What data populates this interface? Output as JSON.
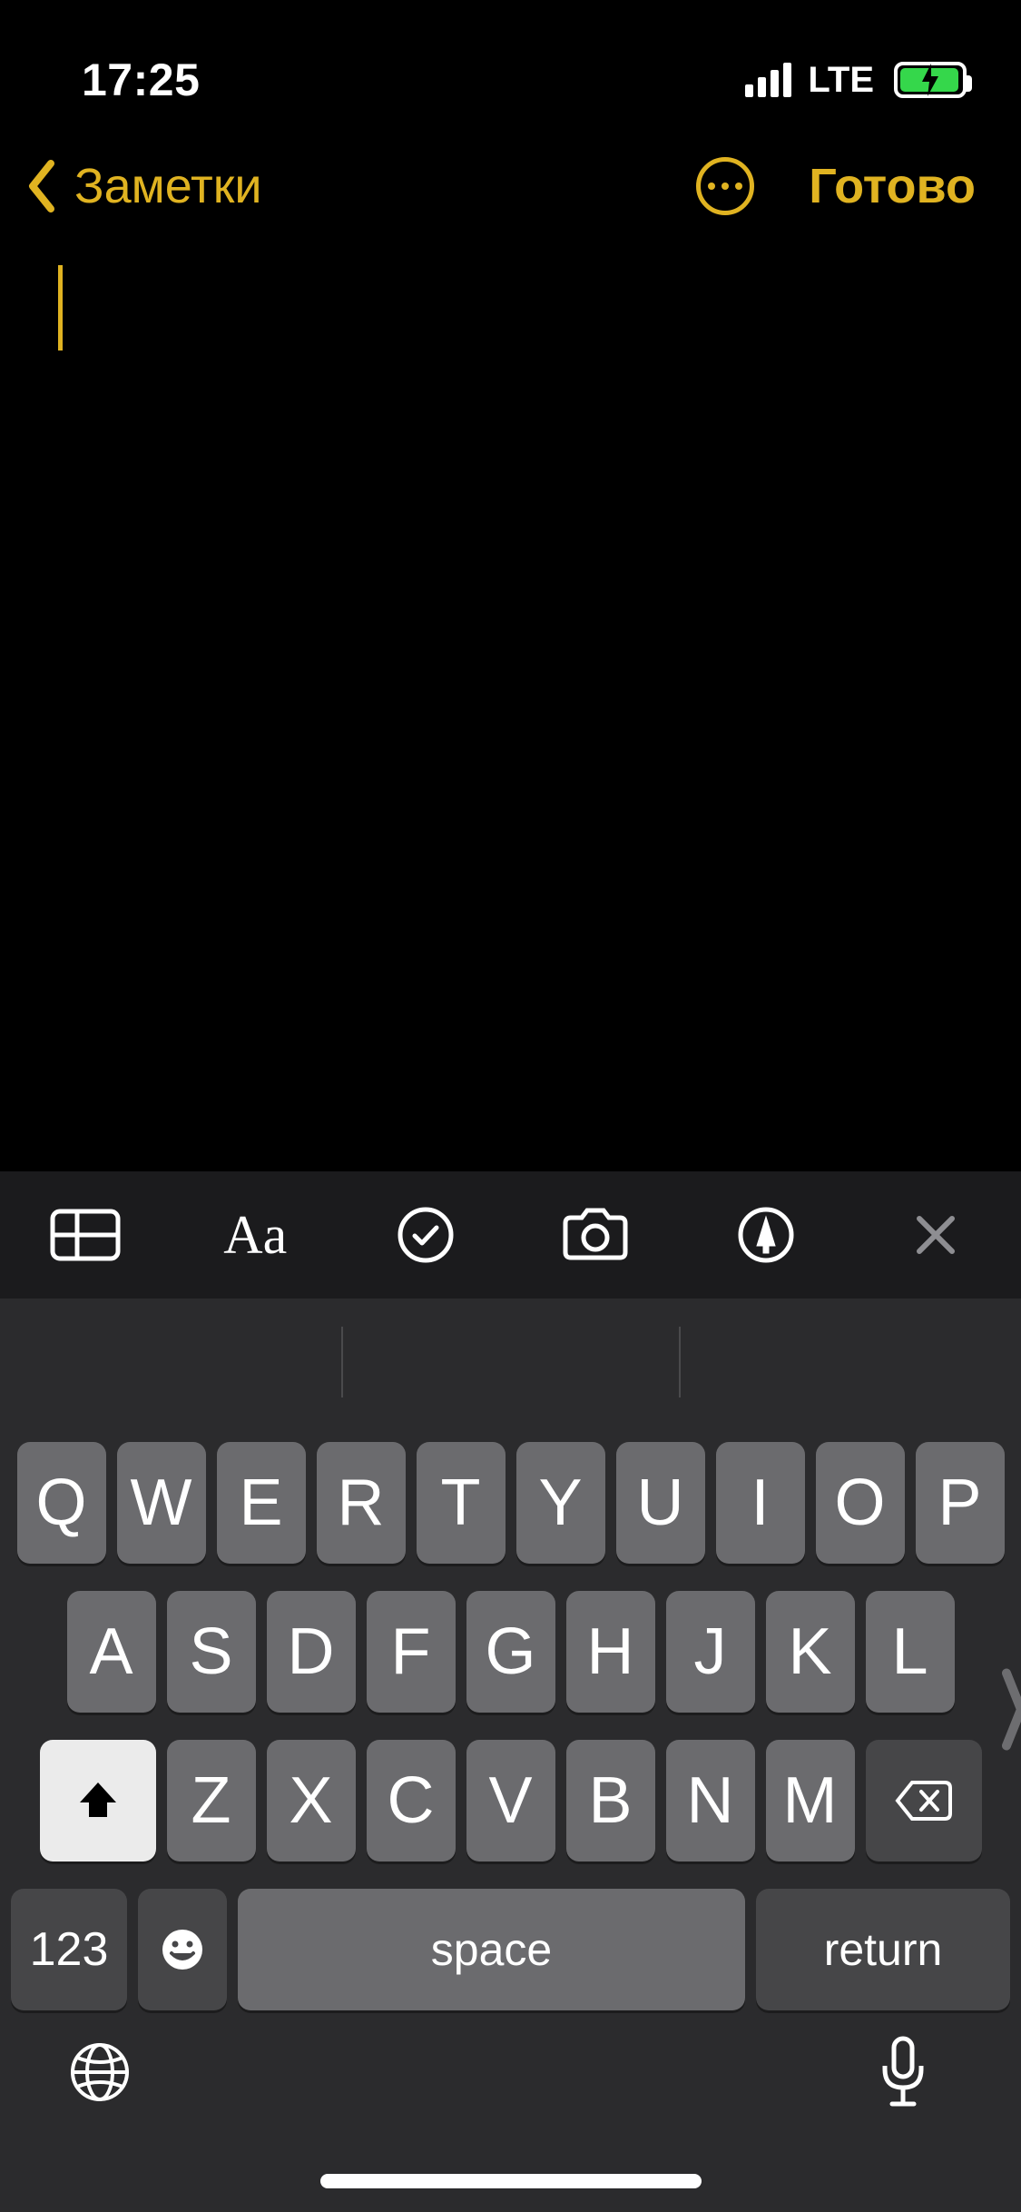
{
  "status": {
    "time": "17:25",
    "network": "LTE"
  },
  "nav": {
    "back_label": "Заметки",
    "done_label": "Готово"
  },
  "toolbar": {
    "aa": "Aa"
  },
  "keyboard": {
    "row1": [
      "Q",
      "W",
      "E",
      "R",
      "T",
      "Y",
      "U",
      "I",
      "O",
      "P"
    ],
    "row2": [
      "A",
      "S",
      "D",
      "F",
      "G",
      "H",
      "J",
      "K",
      "L"
    ],
    "row3": [
      "Z",
      "X",
      "C",
      "V",
      "B",
      "N",
      "M"
    ],
    "num_key": "123",
    "space_label": "space",
    "return_label": "return"
  }
}
